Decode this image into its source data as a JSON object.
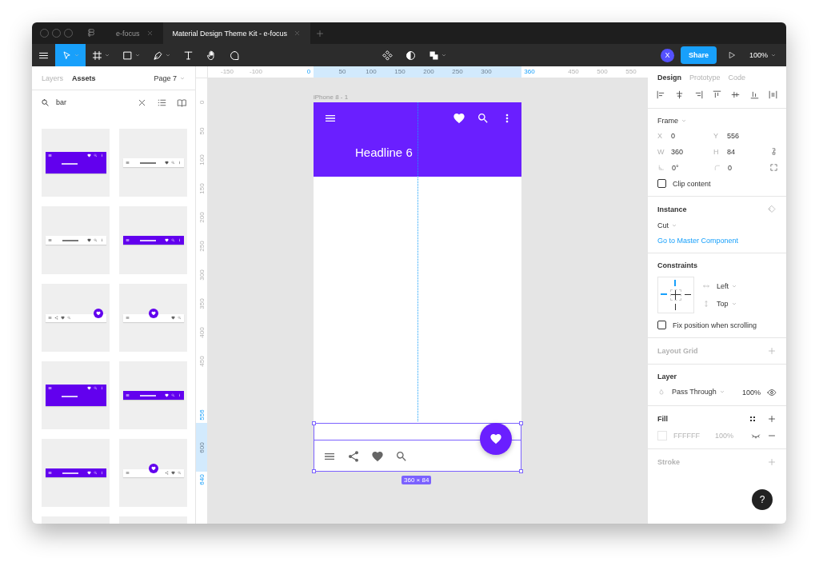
{
  "titlebar": {
    "tabs": [
      {
        "label": "e-focus",
        "selected": false
      },
      {
        "label": "Material Design Theme Kit - e-focus",
        "selected": true
      }
    ]
  },
  "toolbar": {
    "tools": [
      {
        "kind": "move",
        "selected": true,
        "dropdown": true
      },
      {
        "kind": "frame",
        "selected": false,
        "dropdown": true
      },
      {
        "kind": "rectangle",
        "selected": false,
        "dropdown": true
      },
      {
        "kind": "pen",
        "selected": false,
        "dropdown": true
      },
      {
        "kind": "text",
        "selected": false,
        "dropdown": false
      },
      {
        "kind": "hand",
        "selected": false,
        "dropdown": false
      },
      {
        "kind": "comment",
        "selected": false,
        "dropdown": false
      }
    ],
    "center_tools": [
      {
        "kind": "component",
        "dropdown": false
      },
      {
        "kind": "mask",
        "dropdown": false
      },
      {
        "kind": "boolean",
        "dropdown": true
      }
    ],
    "avatar": "X",
    "share": "Share",
    "zoom": "100%"
  },
  "left_panel": {
    "tabs": [
      {
        "label": "Layers",
        "selected": false
      },
      {
        "label": "Assets",
        "selected": true
      }
    ],
    "page": "Page 7",
    "search": {
      "value": "bar"
    },
    "assets": [
      {
        "kind": "top",
        "tall": true,
        "purple": true
      },
      {
        "kind": "top",
        "tall": false,
        "purple": false
      },
      {
        "kind": "top",
        "tall": false,
        "purple": false
      },
      {
        "kind": "top",
        "tall": false,
        "purple": true
      },
      {
        "kind": "bottom",
        "fab_centered": false,
        "share": true
      },
      {
        "kind": "bottom",
        "fab_centered": true,
        "share": false
      },
      {
        "kind": "top",
        "tall": true,
        "purple": true
      },
      {
        "kind": "top",
        "tall": false,
        "purple": true
      },
      {
        "kind": "top",
        "tall": false,
        "purple": true
      },
      {
        "kind": "bottom",
        "fab_centered": true,
        "share": true
      },
      {
        "kind": "cut"
      },
      {
        "kind": "cut"
      }
    ]
  },
  "rulers": {
    "horizontal": [
      {
        "label": "-150",
        "edge": false
      },
      {
        "label": "-100",
        "edge": false
      },
      {
        "label": "0",
        "edge": true
      },
      {
        "label": "50",
        "edge": false
      },
      {
        "label": "100",
        "edge": false
      },
      {
        "label": "150",
        "edge": false
      },
      {
        "label": "200",
        "edge": false
      },
      {
        "label": "250",
        "edge": false
      },
      {
        "label": "300",
        "edge": false
      },
      {
        "label": "360",
        "edge": true
      },
      {
        "label": "450",
        "edge": false
      },
      {
        "label": "500",
        "edge": false
      },
      {
        "label": "550",
        "edge": false
      }
    ],
    "vertical": [
      {
        "label": "0",
        "edge": false
      },
      {
        "label": "50",
        "edge": false
      },
      {
        "label": "100",
        "edge": false
      },
      {
        "label": "150",
        "edge": false
      },
      {
        "label": "200",
        "edge": false
      },
      {
        "label": "250",
        "edge": false
      },
      {
        "label": "300",
        "edge": false
      },
      {
        "label": "350",
        "edge": false
      },
      {
        "label": "400",
        "edge": false
      },
      {
        "label": "450",
        "edge": false
      },
      {
        "label": "556",
        "edge": true
      },
      {
        "label": "600",
        "edge": false
      },
      {
        "label": "640",
        "edge": true
      }
    ]
  },
  "canvas": {
    "frame_label": "iPhone 8 - 1",
    "headline": "Headline 6",
    "size": "360 × 84"
  },
  "design_panel": {
    "tabs": [
      {
        "label": "Design",
        "selected": true
      },
      {
        "label": "Prototype",
        "selected": false
      },
      {
        "label": "Code",
        "selected": false
      }
    ],
    "frame": {
      "title": "Frame",
      "fields": [
        {
          "kind": "text",
          "label": "X",
          "value": "0"
        },
        {
          "kind": "text",
          "label": "Y",
          "value": "556"
        },
        {
          "kind": "text",
          "label": "W",
          "value": "360"
        },
        {
          "kind": "text",
          "label": "H",
          "value": "84"
        },
        {
          "kind": "rotation",
          "value": "0°"
        },
        {
          "kind": "radius",
          "value": "0"
        }
      ],
      "clip_content": {
        "label": "Clip content",
        "checked": false
      }
    },
    "instance": {
      "title": "Instance",
      "variant": "Cut",
      "link": "Go to Master Component"
    },
    "constraints": {
      "title": "Constraints",
      "pins": {
        "left": true,
        "right": false,
        "top": true,
        "bottom": false
      },
      "horizontal": "Left",
      "vertical": "Top",
      "fix_position": {
        "label": "Fix position when scrolling",
        "checked": false
      }
    },
    "layout_grid": {
      "title": "Layout Grid",
      "empty": true
    },
    "layer": {
      "title": "Layer",
      "blend": "Pass Through",
      "opacity": "100%",
      "visible": true
    },
    "fill": {
      "title": "Fill",
      "hex": "FFFFFF",
      "opacity": "100%",
      "visible": false
    },
    "stroke": {
      "title": "Stroke",
      "empty": true
    }
  },
  "help": "?"
}
